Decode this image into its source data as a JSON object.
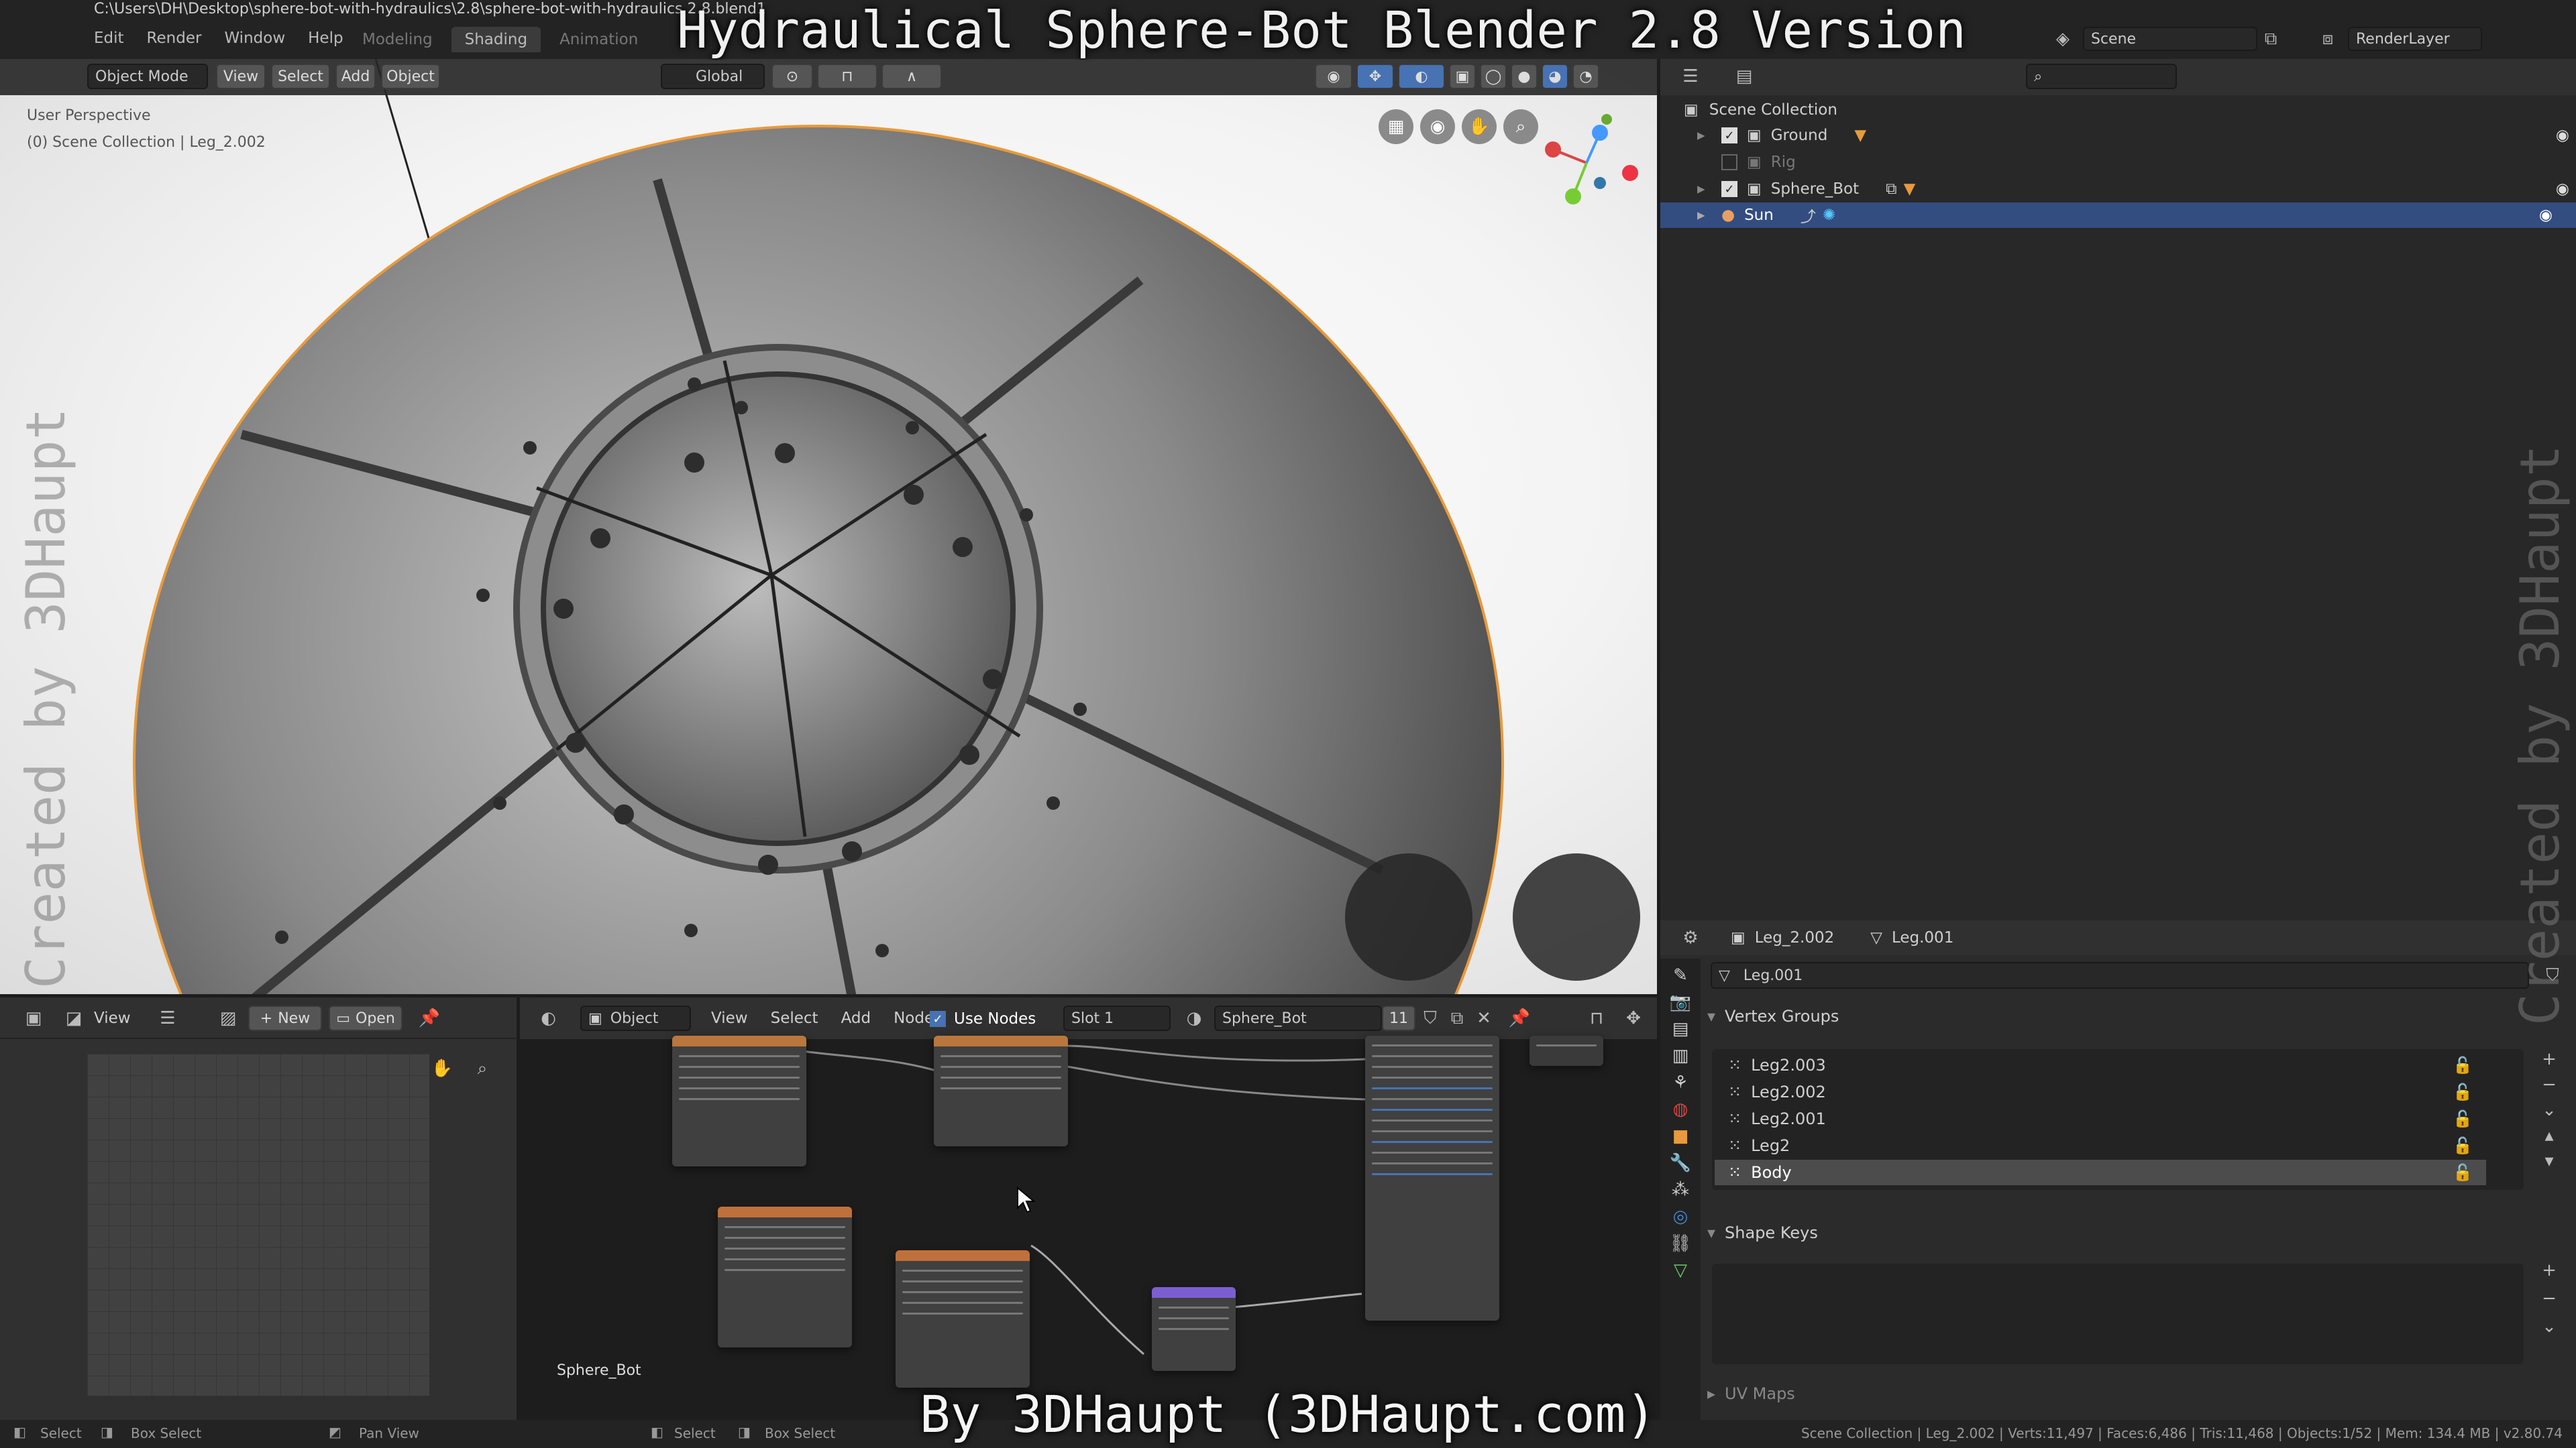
{
  "overlay": {
    "title": "Hydraulical Sphere-Bot Blender 2.8 Version",
    "footer": "By 3DHaupt (3DHaupt.com)",
    "watermark_left": "Created by 3DHaupt",
    "watermark_right": "Created by 3DHaupt"
  },
  "topbar": {
    "file_path": "C:\\Users\\DH\\Desktop\\sphere-bot-with-hydraulics\\2.8\\sphere-bot-with-hydraulics 2.8.blend1",
    "menu": [
      "Edit",
      "Render",
      "Window",
      "Help"
    ],
    "workspaces": [
      "Modeling",
      "Shading",
      "Animation"
    ],
    "scene_name": "Scene",
    "render_layer": "RenderLayer"
  },
  "viewport": {
    "mode": "Object Mode",
    "menus": [
      "View",
      "Select",
      "Add",
      "Object"
    ],
    "transform": "Global",
    "perspective_label": "User Perspective",
    "collection_label": "(0) Scene Collection | Leg_2.002"
  },
  "outliner": {
    "root": "Scene Collection",
    "items": [
      {
        "name": "Ground",
        "checked": true,
        "visible": true
      },
      {
        "name": "Rig",
        "checked": false,
        "visible": false
      },
      {
        "name": "Sphere_Bot",
        "checked": true,
        "visible": true
      },
      {
        "name": "Sun",
        "checked": false,
        "visible": true,
        "selected": true
      }
    ]
  },
  "properties": {
    "object_name": "Leg_2.002",
    "mesh_name": "Leg.001",
    "data_field": "Leg.001",
    "vertex_groups_title": "Vertex Groups",
    "vertex_groups": [
      "Leg2.003",
      "Leg2.002",
      "Leg2.001",
      "Leg2",
      "Body"
    ],
    "active_group": "Body",
    "shape_keys_title": "Shape Keys",
    "uv_maps_title": "UV Maps"
  },
  "image_editor": {
    "menu_view": "View",
    "new_label": "New",
    "open_label": "Open"
  },
  "node_editor": {
    "object_label": "Object",
    "menus": [
      "View",
      "Select",
      "Add",
      "Node"
    ],
    "use_nodes_label": "Use Nodes",
    "use_nodes": true,
    "slot": "Slot 1",
    "material": "Sphere_Bot",
    "users": "11",
    "material_label": "Sphere_Bot"
  },
  "statusbar": {
    "left": [
      "Select",
      "Box Select",
      "Pan View"
    ],
    "mid": [
      "Select",
      "Box Select"
    ],
    "stats": "Scene Collection | Leg_2.002 | Verts:11,497 | Faces:6,486 | Tris:11,468 | Objects:1/52 | Mem: 134.4 MB | v2.80.74"
  }
}
